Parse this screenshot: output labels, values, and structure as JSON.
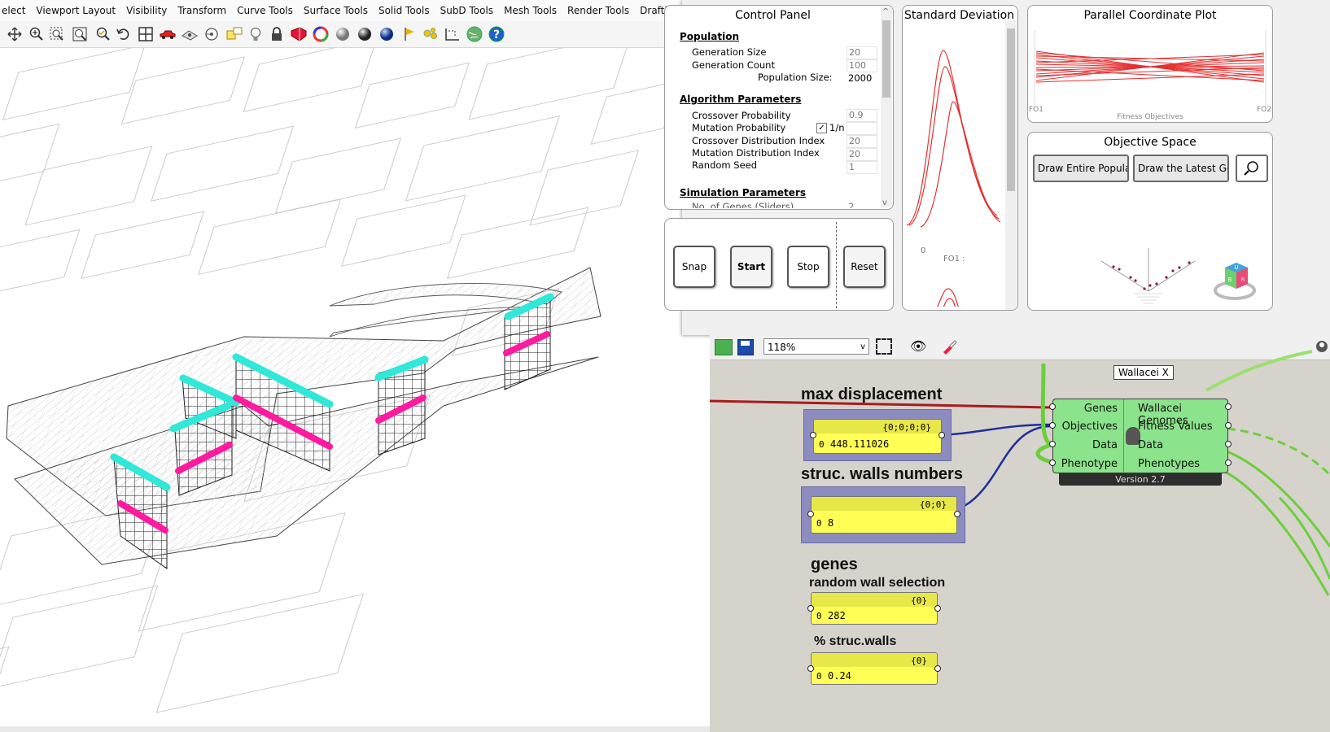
{
  "rhino": {
    "menu": [
      "elect",
      "Viewport Layout",
      "Visibility",
      "Transform",
      "Curve Tools",
      "Surface Tools",
      "Solid Tools",
      "SubD Tools",
      "Mesh Tools",
      "Render Tools",
      "Drafting"
    ],
    "toolbar_icons": [
      "move-icon",
      "zoom-window-icon",
      "zoom-dynamic-icon",
      "zoom-extents-icon",
      "zoom-selected-icon",
      "undo-view-icon",
      "four-viewports-icon",
      "car-icon",
      "named-view-icon",
      "rotate-view-icon",
      "set-cplane-icon",
      "light-bulb-icon",
      "lock-icon",
      "shield-icon",
      "color-wheel-icon",
      "sphere-gray-icon",
      "sphere-dark-icon",
      "sphere-blue-icon",
      "flag-icon",
      "gear-cluster-icon",
      "dimension-icon",
      "globe-icon",
      "help-icon"
    ]
  },
  "control_panel": {
    "title": "Control Panel",
    "population": {
      "heading": "Population",
      "rows": [
        {
          "label": "Generation Size",
          "value": "20"
        },
        {
          "label": "Generation Count",
          "value": "100"
        }
      ],
      "size_label": "Population Size:",
      "size_value": "2000"
    },
    "algorithm": {
      "heading": "Algorithm Parameters",
      "crossover_prob_label": "Crossover Probability",
      "crossover_prob_value": "0.9",
      "mutation_prob_label": "Mutation Probability",
      "mutation_checkbox_label": "1/n",
      "mutation_checked": true,
      "crossover_dist_label": "Crossover Distribution Index",
      "crossover_dist_value": "20",
      "mutation_dist_label": "Mutation Distribution Index",
      "mutation_dist_value": "20",
      "seed_label": "Random Seed",
      "seed_value": "1"
    },
    "simulation": {
      "heading": "Simulation Parameters",
      "genes_label": "No. of Genes (Sliders)",
      "genes_value": "2"
    },
    "buttons": {
      "snap": "Snap",
      "start": "Start",
      "stop": "Stop",
      "reset": "Reset"
    }
  },
  "std_dev_panel": {
    "title": "Standard Deviation G",
    "tick_zero": "0",
    "axis_label": "FO1 :"
  },
  "parallel_plot": {
    "title": "Parallel Coordinate Plot",
    "left_label": "FO1",
    "right_label": "FO2",
    "axis_title": "Fitness Objectives"
  },
  "objective_space": {
    "title": "Objective Space",
    "btn_entire": "Draw Entire Populatic",
    "btn_latest": "Draw the Latest Gene",
    "cube_labels": [
      "U",
      "B",
      "R"
    ]
  },
  "grasshopper": {
    "zoom": "118%",
    "tooltip": "Wallacei X",
    "max_disp": {
      "title": "max displacement",
      "path": "{0;0;0;0}",
      "index": "0",
      "value": "448.111026"
    },
    "struc_walls": {
      "title": "struc. walls numbers",
      "path": "{0;0}",
      "index": "0",
      "value": "8"
    },
    "genes": {
      "title": "genes",
      "subtitle": "random wall selection",
      "path": "{0}",
      "index": "0",
      "value": "282"
    },
    "pct_walls": {
      "title": "% struc.walls",
      "path": "{0}",
      "index": "0",
      "value": "0.24"
    },
    "wallacei": {
      "inputs": [
        "Genes",
        "Objectives",
        "Data",
        "Phenotype"
      ],
      "outputs": [
        "Wallacei Genomes",
        "Fitness Values",
        "Data",
        "Phenotypes"
      ],
      "version": "Version 2.7"
    }
  }
}
